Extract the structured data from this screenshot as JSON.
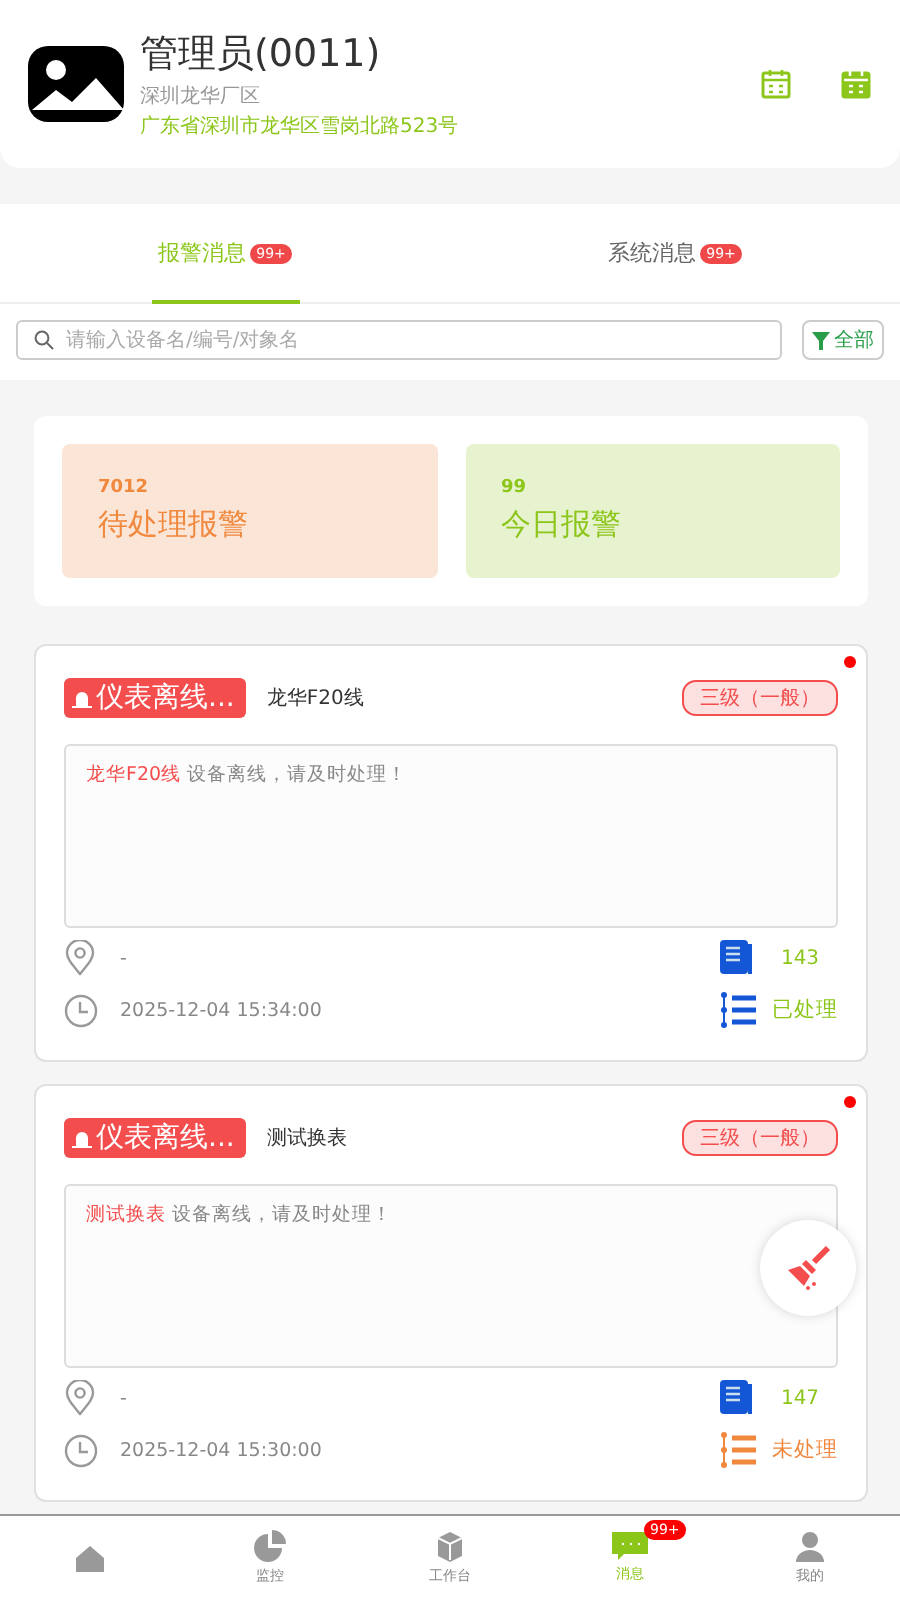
{
  "profile": {
    "name": "管理员(0011)",
    "site": "深圳龙华厂区",
    "address": "广东省深圳市龙华区雪岗北路523号"
  },
  "message_tabs": [
    {
      "label": "报警消息",
      "badge": "99+",
      "selected": true
    },
    {
      "label": "系统消息",
      "badge": "99+",
      "selected": false
    }
  ],
  "search": {
    "placeholder": "请输入设备名/编号/对象名"
  },
  "filter": {
    "label": "全部"
  },
  "stats": [
    {
      "kind": "pending",
      "value": "7012",
      "label": "待处理报警"
    },
    {
      "kind": "today",
      "value": "99",
      "label": "今日报警"
    }
  ],
  "alarms": [
    {
      "type": "仪表离线...",
      "device": "龙华F20线",
      "severity": "三级（一般）",
      "unread": true,
      "subject": "龙华F20线",
      "message": " 设备离线，请及时处理！",
      "location": "-",
      "time": "2025-12-04 15:34:00",
      "count": "143",
      "status": "已处理",
      "handled": true
    },
    {
      "type": "仪表离线...",
      "device": "测试换表",
      "severity": "三级（一般）",
      "unread": true,
      "subject": "测试换表",
      "message": " 设备离线，请及时处理！",
      "location": "-",
      "time": "2025-12-04 15:30:00",
      "count": "147",
      "status": "未处理",
      "handled": false
    }
  ],
  "nav": [
    {
      "kind": "home",
      "selected": false
    },
    {
      "kind": "monitor",
      "label": "监控",
      "selected": false
    },
    {
      "kind": "workbench",
      "label": "工作台",
      "selected": false
    },
    {
      "kind": "messages",
      "label": "消息",
      "badge": "99+",
      "selected": true
    },
    {
      "kind": "me",
      "label": "我的",
      "selected": false
    }
  ]
}
